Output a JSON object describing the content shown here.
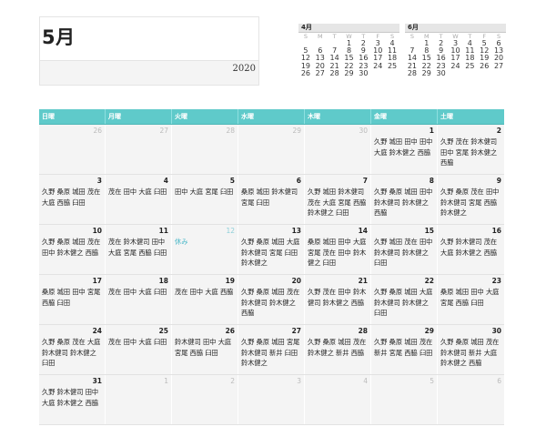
{
  "header": {
    "month_title": "5月",
    "year": "2020"
  },
  "mini_calendars": [
    {
      "label": "4月",
      "weekdays": [
        "S",
        "M",
        "T",
        "W",
        "T",
        "F",
        "S"
      ],
      "days": [
        "",
        "",
        "",
        "1",
        "2",
        "3",
        "4",
        "5",
        "6",
        "7",
        "8",
        "9",
        "10",
        "11",
        "12",
        "13",
        "14",
        "15",
        "16",
        "17",
        "18",
        "19",
        "20",
        "21",
        "22",
        "23",
        "24",
        "25",
        "26",
        "27",
        "28",
        "29",
        "30",
        "",
        ""
      ]
    },
    {
      "label": "6月",
      "weekdays": [
        "S",
        "M",
        "T",
        "W",
        "T",
        "F",
        "S"
      ],
      "days": [
        "",
        "1",
        "2",
        "3",
        "4",
        "5",
        "6",
        "7",
        "8",
        "9",
        "10",
        "11",
        "12",
        "13",
        "14",
        "15",
        "16",
        "17",
        "18",
        "19",
        "20",
        "21",
        "22",
        "23",
        "24",
        "25",
        "26",
        "27",
        "28",
        "29",
        "30",
        "",
        "",
        "",
        ""
      ]
    }
  ],
  "weekday_headers": [
    "日曜",
    "月曜",
    "火曜",
    "水曜",
    "木曜",
    "金曜",
    "土曜"
  ],
  "weeks": [
    [
      {
        "day": "26",
        "other": true,
        "note": ""
      },
      {
        "day": "27",
        "other": true,
        "note": ""
      },
      {
        "day": "28",
        "other": true,
        "note": ""
      },
      {
        "day": "29",
        "other": true,
        "note": ""
      },
      {
        "day": "30",
        "other": true,
        "note": ""
      },
      {
        "day": "1",
        "note": "久野 城田 田中 田中 大庭 鈴木健之 西脇"
      },
      {
        "day": "2",
        "note": "久野 茂在 鈴木健司 田中 宮尾 鈴木健之 西脇"
      }
    ],
    [
      {
        "day": "3",
        "note": "久野 桑原 城田 茂在 大庭 西脇 臼田"
      },
      {
        "day": "4",
        "note": "茂在 田中 大庭 臼田"
      },
      {
        "day": "5",
        "note": "田中 大庭 宮尾 臼田"
      },
      {
        "day": "6",
        "note": "桑原 城田 鈴木健司 宮尾 臼田"
      },
      {
        "day": "7",
        "note": "久野 城田 鈴木健司 茂在 大庭 宮尾 西脇 鈴木健之 臼田"
      },
      {
        "day": "8",
        "note": "久野 桑原 城田 田中 鈴木健司 鈴木健之 西脇"
      },
      {
        "day": "9",
        "note": "久野 桑原 茂在 田中 鈴木健司 宮尾 西脇 鈴木健之"
      }
    ],
    [
      {
        "day": "10",
        "note": "久野 桑原 城田 茂在 田中 鈴木健之 西脇"
      },
      {
        "day": "11",
        "note": "茂在 鈴木健司 田中 大庭 宮尾 西脇 臼田"
      },
      {
        "day": "12",
        "holiday": true,
        "note": "休み"
      },
      {
        "day": "13",
        "note": "久野 桑原 城田 大庭 鈴木健司 宮尾 臼田 鈴木健之"
      },
      {
        "day": "14",
        "note": "桑原 城田 田中 大庭 宮尾 茂在 田中 鈴木健之 臼田"
      },
      {
        "day": "15",
        "note": "久野 城田 茂在 田中 鈴木健司 鈴木健之 臼田"
      },
      {
        "day": "16",
        "note": "久野 鈴木健司 茂在 大庭 鈴木健之 西脇"
      }
    ],
    [
      {
        "day": "17",
        "note": "桑原 城田 田中 宮尾 西脇 臼田"
      },
      {
        "day": "18",
        "note": "茂在 田中 大庭 臼田"
      },
      {
        "day": "19",
        "note": "茂在 田中 大庭 西脇"
      },
      {
        "day": "20",
        "note": "久野 桑原 城田 茂在 鈴木健司 鈴木健之 西脇"
      },
      {
        "day": "21",
        "note": "久野 茂在 田中 鈴木健司 鈴木健之 西脇"
      },
      {
        "day": "22",
        "note": "久野 桑原 城田 大庭 鈴木健司 鈴木健之 臼田"
      },
      {
        "day": "23",
        "note": "桑原 城田 田中 大庭 宮尾 西脇 臼田"
      }
    ],
    [
      {
        "day": "24",
        "note": "久野 桑原 茂在 大庭 鈴木健司 鈴木健之 臼田"
      },
      {
        "day": "25",
        "note": "茂在 田中 大庭 臼田"
      },
      {
        "day": "26",
        "note": "鈴木健司 田中 大庭 宮尾 西脇 臼田"
      },
      {
        "day": "27",
        "note": "久野 桑原 城田 宮尾 鈴木健司 新井 臼田 鈴木健之"
      },
      {
        "day": "28",
        "note": "久野 桑原 城田 茂在 鈴木健之 新井 西脇"
      },
      {
        "day": "29",
        "note": "久野 桑原 城田 茂在 新井 宮尾 西脇 臼田"
      },
      {
        "day": "30",
        "note": "久野 桑原 城田 茂在 鈴木健司 新井 大庭 鈴木健之 西脇"
      }
    ],
    [
      {
        "day": "31",
        "note": "久野 鈴木健司 田中 大庭 鈴木健之 西脇"
      },
      {
        "day": "1",
        "other": true,
        "note": ""
      },
      {
        "day": "2",
        "other": true,
        "note": ""
      },
      {
        "day": "3",
        "other": true,
        "note": ""
      },
      {
        "day": "4",
        "other": true,
        "note": ""
      },
      {
        "day": "5",
        "other": true,
        "note": ""
      },
      {
        "day": "6",
        "other": true,
        "note": ""
      }
    ]
  ]
}
